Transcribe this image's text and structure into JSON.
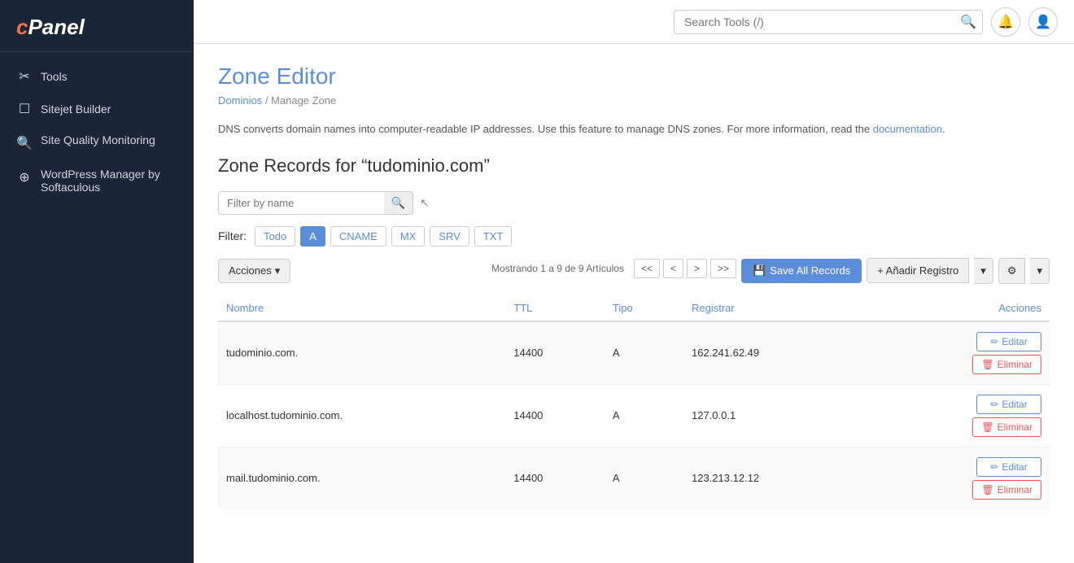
{
  "sidebar": {
    "logo": "cPanel",
    "logo_c": "c",
    "items": [
      {
        "id": "tools",
        "label": "Tools",
        "icon": "✂"
      },
      {
        "id": "sitejet",
        "label": "Sitejet Builder",
        "icon": "⬜"
      },
      {
        "id": "site-quality",
        "label": "Site Quality Monitoring",
        "icon": "🔍"
      },
      {
        "id": "wordpress",
        "label": "WordPress Manager by Softaculous",
        "icon": "⊕"
      }
    ]
  },
  "topbar": {
    "search_placeholder": "Search Tools (/)",
    "search_icon": "🔍",
    "bell_icon": "🔔",
    "user_icon": "👤"
  },
  "page": {
    "title": "Zone Editor",
    "breadcrumb_part1": "Dominios",
    "breadcrumb_separator": "/",
    "breadcrumb_part2": "Manage Zone",
    "info_text": "DNS converts domain names into computer-readable IP addresses. Use this feature to manage DNS zones. For more information, read the",
    "info_link": "documentation",
    "info_text_end": ".",
    "zone_title": "Zone Records for “tudominio.com”"
  },
  "filter": {
    "placeholder": "Filter by name",
    "label": "Filter:",
    "types": [
      {
        "id": "todo",
        "label": "Todo",
        "active": false
      },
      {
        "id": "a",
        "label": "A",
        "active": true
      },
      {
        "id": "cname",
        "label": "CNAME",
        "active": false
      },
      {
        "id": "mx",
        "label": "MX",
        "active": false
      },
      {
        "id": "srv",
        "label": "SRV",
        "active": false
      },
      {
        "id": "txt",
        "label": "TXT",
        "active": false
      }
    ]
  },
  "actions": {
    "acciones_label": "Acciones",
    "save_all_label": "Save All Records",
    "add_record_label": "+ Añadir Registro"
  },
  "pagination": {
    "info": "Mostrando 1 a 9 de 9 Artículos",
    "first": "<<",
    "prev": "<",
    "next": ">",
    "last": ">>"
  },
  "table": {
    "columns": [
      "Nombre",
      "TTL",
      "Tipo",
      "Registrar",
      "Acciones"
    ],
    "rows": [
      {
        "nombre": "tudominio.com.",
        "ttl": "14400",
        "tipo": "A",
        "registrar": "162.241.62.49",
        "edit": "Editar",
        "delete": "Eliminar"
      },
      {
        "nombre": "localhost.tudominio.com.",
        "ttl": "14400",
        "tipo": "A",
        "registrar": "127.0.0.1",
        "edit": "Editar",
        "delete": "Eliminar"
      },
      {
        "nombre": "mail.tudominio.com.",
        "ttl": "14400",
        "tipo": "A",
        "registrar": "123.213.12.12",
        "edit": "Editar",
        "delete": "Eliminar"
      }
    ]
  }
}
